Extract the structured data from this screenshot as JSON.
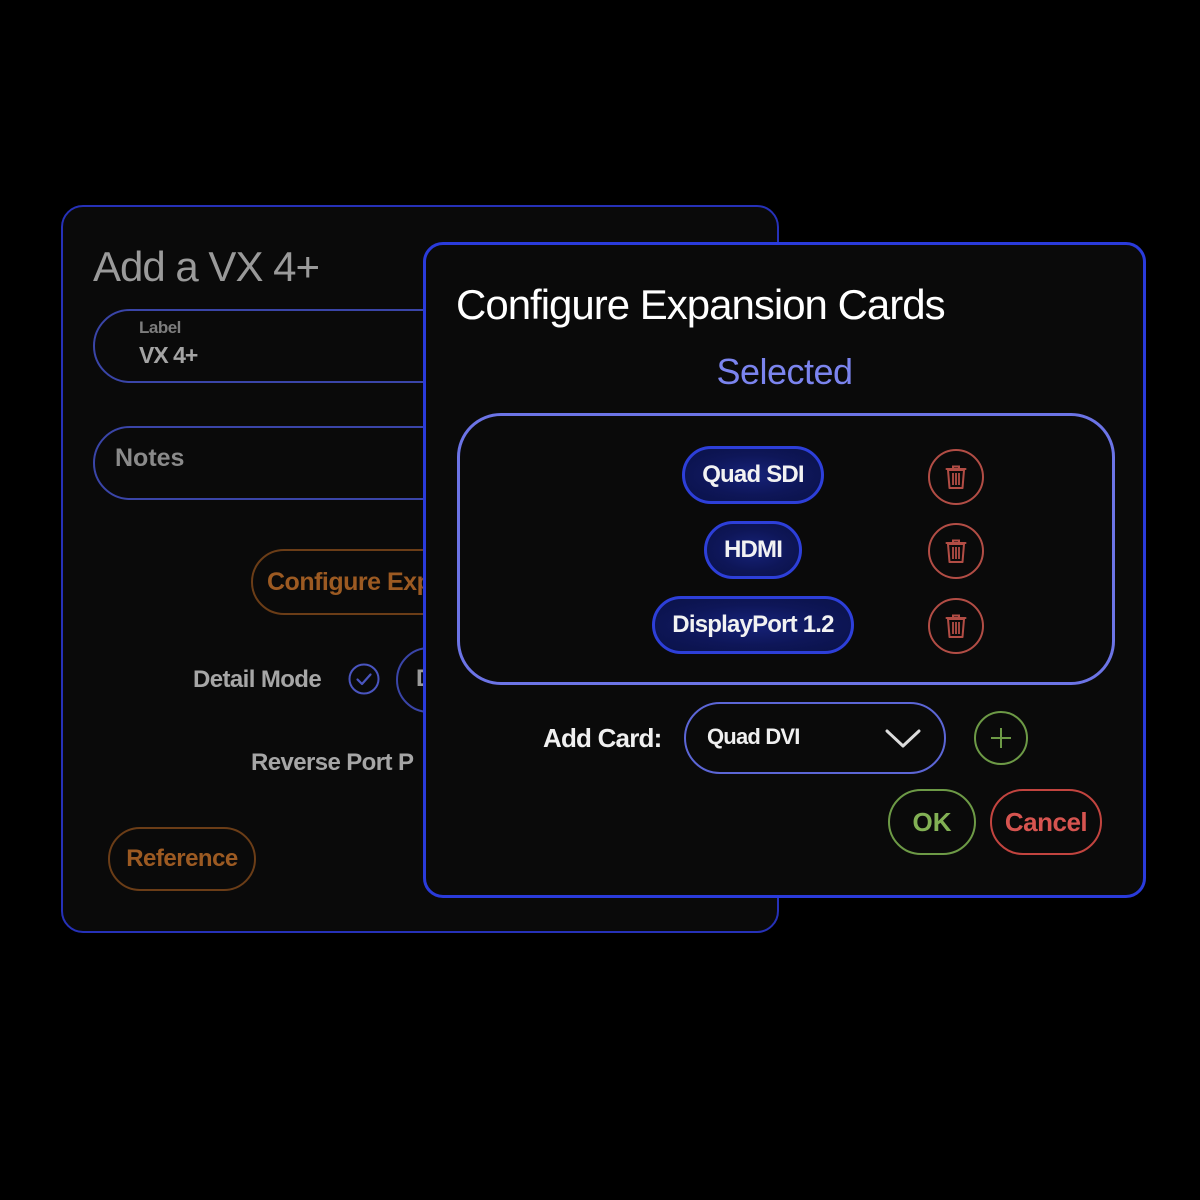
{
  "background_dialog": {
    "title": "Add a VX 4+",
    "label_field": {
      "label": "Label",
      "value": "VX 4+"
    },
    "notes_field": {
      "placeholder": "Notes"
    },
    "configure_button_label": "Configure Expansion Cards",
    "detail_mode": {
      "label": "Detail Mode",
      "checked": true,
      "partial_pill_text": "D"
    },
    "reverse_port_label": "Reverse Port P",
    "reference_button_label": "Reference"
  },
  "configure_dialog": {
    "title": "Configure Expansion Cards",
    "selected_heading": "Selected",
    "selected_cards": [
      {
        "label": "Quad SDI",
        "delete_icon": "trash-icon"
      },
      {
        "label": "HDMI",
        "delete_icon": "trash-icon"
      },
      {
        "label": "DisplayPort 1.2",
        "delete_icon": "trash-icon"
      }
    ],
    "add_card": {
      "label": "Add Card:",
      "selected_option": "Quad DVI",
      "dropdown_icon": "chevron-down-icon",
      "add_icon": "plus-icon"
    },
    "ok_label": "OK",
    "cancel_label": "Cancel"
  },
  "colors": {
    "dialog_border": "#2a3bdb",
    "selected_accent": "#7b84ee",
    "chip_fill": "#0e1658",
    "delete": "#b24d45",
    "confirm": "#6d9a46",
    "cancel": "#d65450",
    "secondary_button": "#9c5a22"
  }
}
